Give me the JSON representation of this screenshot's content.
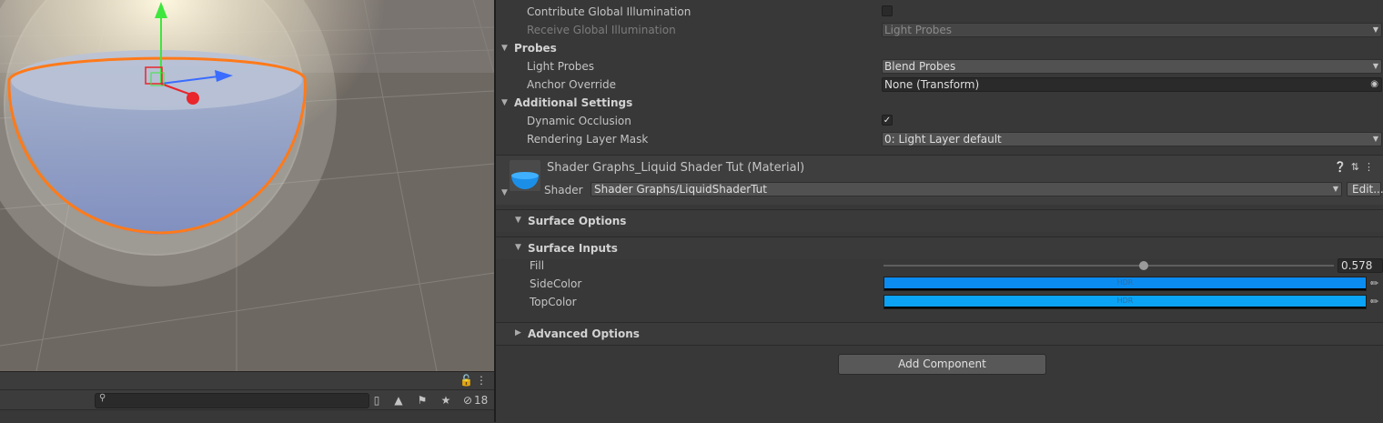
{
  "colors": {
    "accent_orange": "#ff7a1a",
    "liquid_blue": "#1b8fe8",
    "side_color": "#0b8cf0",
    "top_color": "#0aa3f5",
    "gizmo_green": "#3ee63e",
    "gizmo_blue": "#3a6cff",
    "gizmo_red": "#e8262b"
  },
  "project_panel": {
    "header_icons": [
      "lock-icon",
      "kebab-menu-icon"
    ],
    "search": {
      "value": "",
      "placeholder": ""
    },
    "toolbar_icons": [
      "create-icon",
      "filter-type-icon",
      "label-icon",
      "favorite-star-icon",
      "hidden-eye-icon"
    ],
    "hidden_count": "18"
  },
  "renderer": {
    "contribute_gi_label": "Contribute Global Illumination",
    "contribute_gi_checked": false,
    "receive_gi_label": "Receive Global Illumination",
    "receive_gi_value": "Light Probes",
    "probes_header": "Probes",
    "light_probes_label": "Light Probes",
    "light_probes_value": "Blend Probes",
    "anchor_override_label": "Anchor Override",
    "anchor_override_value": "None (Transform)",
    "additional_header": "Additional Settings",
    "dynamic_occlusion_label": "Dynamic Occlusion",
    "dynamic_occlusion_checked": true,
    "rendering_layer_mask_label": "Rendering Layer Mask",
    "rendering_layer_mask_value": "0: Light Layer default"
  },
  "material": {
    "title": "Shader Graphs_Liquid Shader Tut (Material)",
    "header_icons": [
      "help-icon",
      "preset-icon",
      "kebab-menu-icon"
    ],
    "shader_label": "Shader",
    "shader_value": "Shader Graphs/LiquidShaderTut",
    "edit_label": "Edit...",
    "surface_options_label": "Surface Options",
    "surface_inputs_label": "Surface Inputs",
    "fill_label": "Fill",
    "fill_value": "0.578",
    "fill_fraction": 0.578,
    "side_color_label": "SideColor",
    "top_color_label": "TopColor",
    "hdr_badge": "HDR",
    "advanced_options_label": "Advanced Options"
  },
  "add_component_label": "Add Component"
}
